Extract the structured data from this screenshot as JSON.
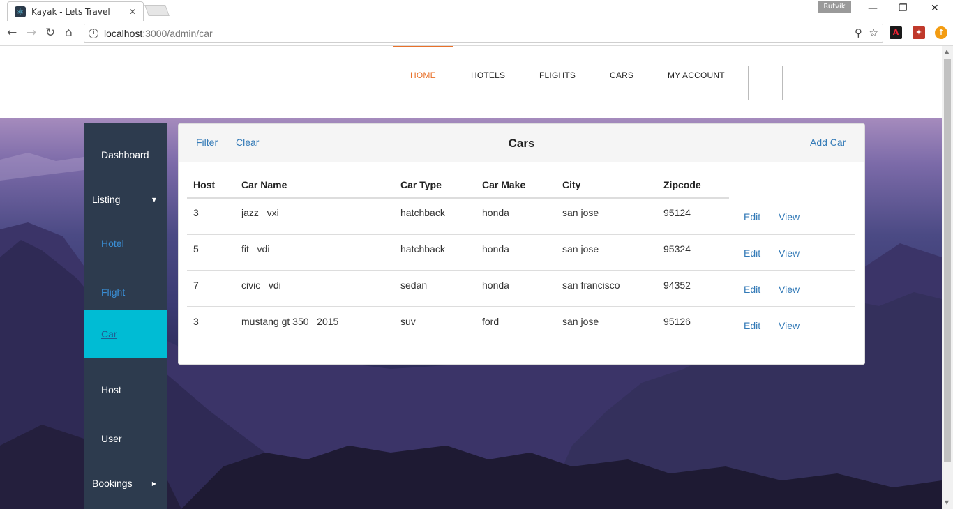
{
  "browser": {
    "tab_title": "Kayak - Lets Travel",
    "tab_close": "✕",
    "profile_name": "Rutvik",
    "url_host": "localhost",
    "url_path": ":3000/admin/car",
    "window_controls": [
      "—",
      "❐",
      "✕"
    ]
  },
  "topnav": {
    "items": [
      "HOME",
      "HOTELS",
      "FLIGHTS",
      "CARS",
      "MY ACCOUNT"
    ],
    "active": "HOME",
    "accent_color": "#e8712a"
  },
  "sidebar": {
    "dashboard": "Dashboard",
    "listing": "Listing",
    "hotel": "Hotel",
    "flight": "Flight",
    "car": "Car",
    "host": "Host",
    "user": "User",
    "bookings": "Bookings",
    "active_color": "#00bcd4",
    "bg_color": "#2d3b4e"
  },
  "panel": {
    "filter": "Filter",
    "clear": "Clear",
    "title": "Cars",
    "add": "Add Car"
  },
  "table": {
    "headers": [
      "Host",
      "Car Name",
      "Car Type",
      "Car Make",
      "City",
      "Zipcode"
    ],
    "rows": [
      {
        "host": "3",
        "name": "jazz   vxi",
        "type": "hatchback",
        "make": "honda",
        "city": "san jose",
        "zip": "95124"
      },
      {
        "host": "5",
        "name": "fit   vdi",
        "type": "hatchback",
        "make": "honda",
        "city": "san jose",
        "zip": "95324"
      },
      {
        "host": "7",
        "name": "civic   vdi",
        "type": "sedan",
        "make": "honda",
        "city": "san francisco",
        "zip": "94352"
      },
      {
        "host": "3",
        "name": "mustang gt 350   2015",
        "type": "suv",
        "make": "ford",
        "city": "san jose",
        "zip": "95126"
      }
    ],
    "edit_label": "Edit",
    "view_label": "View"
  }
}
